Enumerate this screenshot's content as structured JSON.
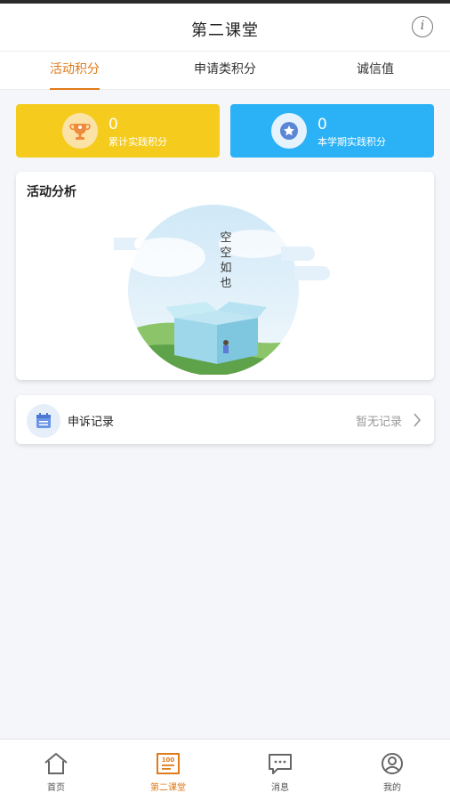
{
  "header": {
    "title": "第二课堂",
    "info_icon": "info-icon"
  },
  "tabs": [
    {
      "label": "活动积分",
      "active": true
    },
    {
      "label": "申请类积分",
      "active": false
    },
    {
      "label": "诚信值",
      "active": false
    }
  ],
  "score_cards": [
    {
      "value": "0",
      "label": "累计实践积分",
      "color": "#f5cb1d",
      "icon": "trophy-icon"
    },
    {
      "value": "0",
      "label": "本学期实践积分",
      "color": "#2bb2f6",
      "icon": "star-medal-icon"
    }
  ],
  "analysis": {
    "title": "活动分析",
    "empty_text": "空空如也",
    "illustration": "empty-box-illustration"
  },
  "appeal": {
    "title": "申诉记录",
    "status": "暂无记录",
    "icon": "calendar-icon"
  },
  "bottom_nav": [
    {
      "label": "首页",
      "icon": "home-icon",
      "active": false
    },
    {
      "label": "第二课堂",
      "icon": "score-board-icon",
      "active": true
    },
    {
      "label": "消息",
      "icon": "message-icon",
      "active": false
    },
    {
      "label": "我的",
      "icon": "profile-icon",
      "active": false
    }
  ],
  "colors": {
    "accent": "#e07a1b",
    "yellow_card": "#f5cb1d",
    "blue_card": "#2bb2f6"
  }
}
